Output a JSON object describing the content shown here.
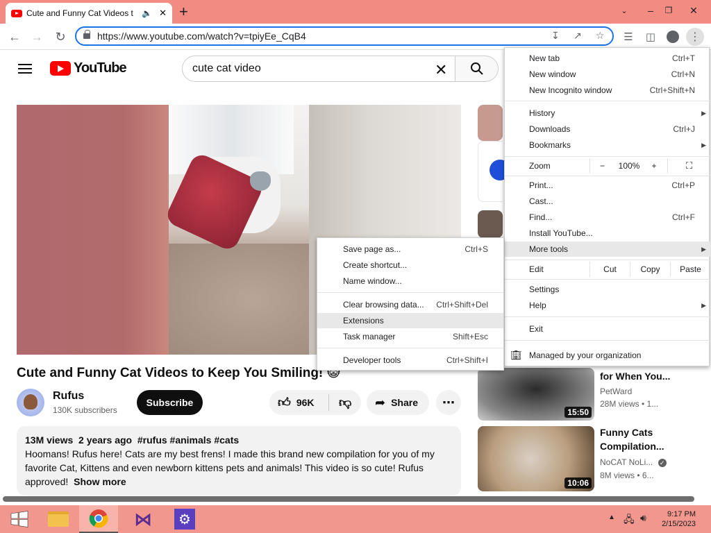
{
  "browser": {
    "tab_title": "Cute and Funny Cat Videos t",
    "url": "https://www.youtube.com/watch?v=tpiyEe_CqB4",
    "accent": "#1a73e8",
    "titlebar_color": "#f28b82"
  },
  "youtube": {
    "logo_text": "YouTube",
    "search_value": "cute cat video",
    "video_title": "Cute and Funny Cat Videos to Keep You Smiling! 😺",
    "channel_name": "Rufus",
    "subscribers": "130K subscribers",
    "subscribe_label": "Subscribe",
    "likes": "96K",
    "share_label": "Share",
    "description": {
      "meta": "13M views  2 years ago  #rufus #animals #cats",
      "text": "Hoomans! Rufus here! Cats are my best frens! I made this brand new compilation for you of my favorite Cat, Kittens and even newborn kittens pets and animals! This video is so cute! Rufus approved!",
      "show_more": "Show more"
    },
    "suggestions": [
      {
        "title": "for When You...",
        "channel": "PetWard",
        "views": "28M views • 1...",
        "duration": "15:50"
      },
      {
        "title": "Funny Cats Compilation...",
        "channel": "NoCAT NoLi...",
        "views": "8M views • 6...",
        "duration": "10:06"
      }
    ]
  },
  "chrome_menu": {
    "items": [
      {
        "label": "New tab",
        "shortcut": "Ctrl+T"
      },
      {
        "label": "New window",
        "shortcut": "Ctrl+N"
      },
      {
        "label": "New Incognito window",
        "shortcut": "Ctrl+Shift+N"
      },
      {
        "label": "History",
        "shortcut": ""
      },
      {
        "label": "Downloads",
        "shortcut": "Ctrl+J"
      },
      {
        "label": "Bookmarks",
        "shortcut": ""
      },
      {
        "label": "Print...",
        "shortcut": "Ctrl+P"
      },
      {
        "label": "Cast...",
        "shortcut": ""
      },
      {
        "label": "Find...",
        "shortcut": "Ctrl+F"
      },
      {
        "label": "Install YouTube...",
        "shortcut": ""
      },
      {
        "label": "More tools",
        "shortcut": ""
      },
      {
        "label": "Settings",
        "shortcut": ""
      },
      {
        "label": "Help",
        "shortcut": ""
      },
      {
        "label": "Exit",
        "shortcut": ""
      }
    ],
    "zoom": {
      "label": "Zoom",
      "minus": "−",
      "value": "100%",
      "plus": "+"
    },
    "edit": {
      "label": "Edit",
      "cut": "Cut",
      "copy": "Copy",
      "paste": "Paste"
    },
    "managed": "Managed by your organization"
  },
  "more_tools_menu": {
    "items": [
      {
        "label": "Save page as...",
        "shortcut": "Ctrl+S"
      },
      {
        "label": "Create shortcut...",
        "shortcut": ""
      },
      {
        "label": "Name window...",
        "shortcut": ""
      },
      {
        "label": "Clear browsing data...",
        "shortcut": "Ctrl+Shift+Del"
      },
      {
        "label": "Extensions",
        "shortcut": ""
      },
      {
        "label": "Task manager",
        "shortcut": "Shift+Esc"
      },
      {
        "label": "Developer tools",
        "shortcut": "Ctrl+Shift+I"
      }
    ]
  },
  "taskbar": {
    "time": "9:17 PM",
    "date": "2/15/2023"
  }
}
